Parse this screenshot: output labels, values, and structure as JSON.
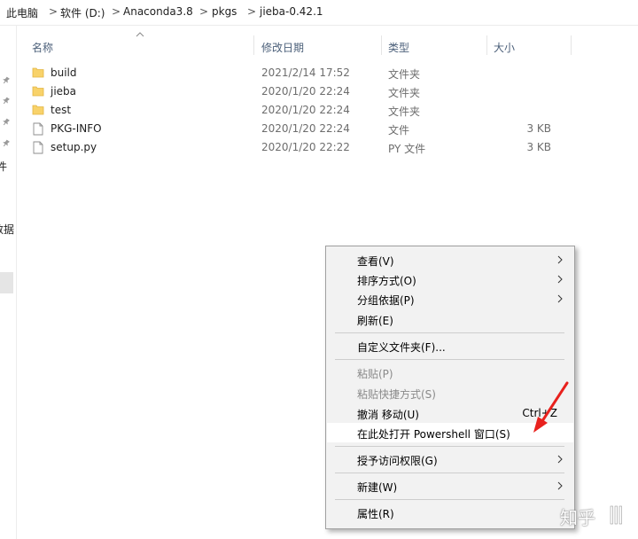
{
  "breadcrumb": {
    "items": [
      "此电脑",
      "软件 (D:)",
      "Anaconda3.8",
      "pkgs",
      "jieba-0.42.1"
    ],
    "separator": ">"
  },
  "nav": {
    "partial_labels": [
      "件",
      "数据"
    ]
  },
  "columns": {
    "name": "名称",
    "date": "修改日期",
    "type": "类型",
    "size": "大小"
  },
  "files": [
    {
      "name": "build",
      "date": "2021/2/14 17:52",
      "type": "文件夹",
      "size": "",
      "icon": "folder-icon"
    },
    {
      "name": "jieba",
      "date": "2020/1/20 22:24",
      "type": "文件夹",
      "size": "",
      "icon": "folder-icon"
    },
    {
      "name": "test",
      "date": "2020/1/20 22:24",
      "type": "文件夹",
      "size": "",
      "icon": "folder-icon"
    },
    {
      "name": "PKG-INFO",
      "date": "2020/1/20 22:24",
      "type": "文件",
      "size": "3 KB",
      "icon": "file-icon"
    },
    {
      "name": "setup.py",
      "date": "2020/1/20 22:22",
      "type": "PY 文件",
      "size": "3 KB",
      "icon": "file-icon"
    }
  ],
  "context_menu": {
    "view": "查看(V)",
    "sort": "排序方式(O)",
    "group": "分组依据(P)",
    "refresh": "刷新(E)",
    "customize": "自定义文件夹(F)...",
    "paste": "粘贴(P)",
    "paste_shortcut": "粘贴快捷方式(S)",
    "undo": "撤消 移动(U)",
    "undo_shortcut": "Ctrl+Z",
    "powershell": "在此处打开 Powershell 窗口(S)",
    "access": "授予访问权限(G)",
    "new": "新建(W)",
    "properties": "属性(R)"
  },
  "watermark": "知乎",
  "colors": {
    "header_text": "#4c607a",
    "folder": "#f8d26a",
    "annotation_arrow": "#e8211d"
  }
}
